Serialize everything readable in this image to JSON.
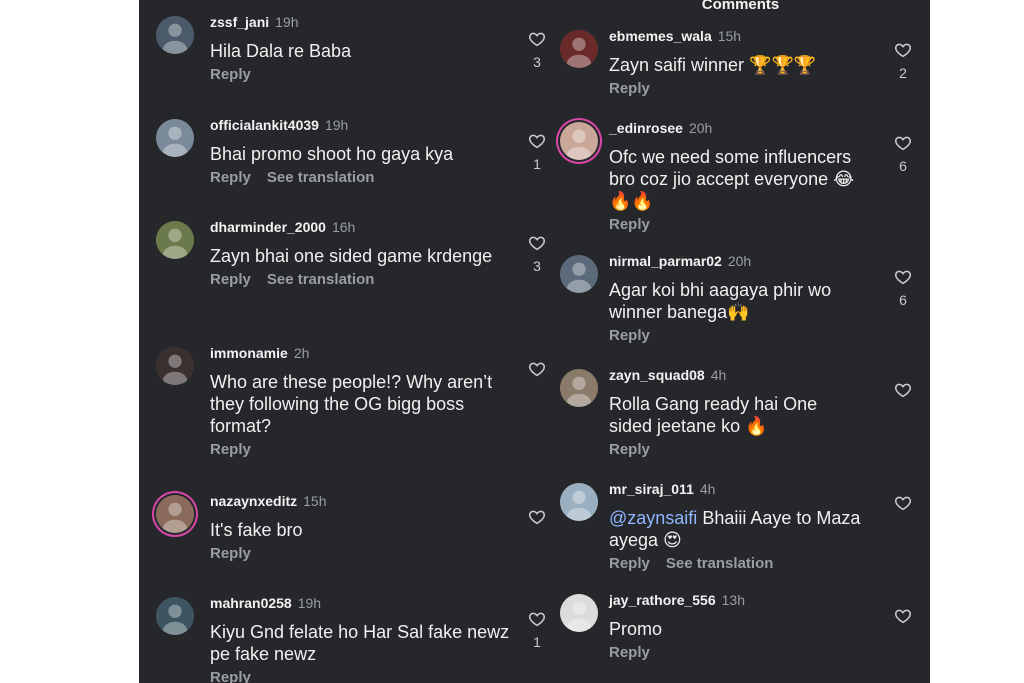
{
  "header": {
    "title": "Comments"
  },
  "left_comments": [
    {
      "user": "zssf_jani",
      "time": "19h",
      "text": "Hila Dala re Baba",
      "actions": [
        "Reply"
      ],
      "likes": "3",
      "avatar_color": "#4a5a6a"
    },
    {
      "user": "officialankit4039",
      "time": "19h",
      "text": "Bhai promo shoot ho gaya kya",
      "actions": [
        "Reply",
        "See translation"
      ],
      "likes": "1",
      "avatar_color": "#7a8a9a"
    },
    {
      "user": "dharminder_2000",
      "time": "16h",
      "text": "Zayn bhai one sided game krdenge",
      "actions": [
        "Reply",
        "See translation"
      ],
      "likes": "3",
      "avatar_color": "#6b7a4a"
    },
    {
      "user": "immonamie",
      "time": "2h",
      "text": "Who are these people!? Why aren’t they following the OG bigg boss format?",
      "actions": [
        "Reply"
      ],
      "likes": "",
      "avatar_color": "#3a3030"
    },
    {
      "user": "nazaynxeditz",
      "time": "15h",
      "text": "It's fake bro",
      "actions": [
        "Reply"
      ],
      "likes": "",
      "avatar_color": "#8a6a5a"
    },
    {
      "user": "mahran0258",
      "time": "19h",
      "text": "Kiyu Gnd felate ho Har Sal fake newz pe fake newz",
      "actions": [
        "Reply"
      ],
      "likes": "1",
      "avatar_color": "#3d5560"
    }
  ],
  "right_comments": [
    {
      "user": "ebmemes_wala",
      "time": "15h",
      "text": "Zayn saifi winner 🏆🏆🏆",
      "actions": [
        "Reply"
      ],
      "likes": "2",
      "avatar_color": "#6a2a2a"
    },
    {
      "user": "_edinrosee",
      "time": "20h",
      "text": "Ofc we need some influencers bro coz jio accept everyone 😂 🔥🔥",
      "actions": [
        "Reply"
      ],
      "likes": "6",
      "avatar_color": "#c9a89a"
    },
    {
      "user": "nirmal_parmar02",
      "time": "20h",
      "text": "Agar koi bhi aagaya phir wo winner banega🙌",
      "actions": [
        "Reply"
      ],
      "likes": "6",
      "avatar_color": "#5a6a7a"
    },
    {
      "user": "zayn_squad08",
      "time": "4h",
      "text": "Rolla Gang ready hai One sided jeetane ko 🔥",
      "actions": [
        "Reply"
      ],
      "likes": "",
      "avatar_color": "#8a7a6a"
    },
    {
      "user": "mr_siraj_011",
      "time": "4h",
      "mention": "@zaynsaifi",
      "text": " Bhaiii Aaye to Maza ayega 😍",
      "actions": [
        "Reply",
        "See translation"
      ],
      "likes": "",
      "avatar_color": "#9ab0c0"
    },
    {
      "user": "jay_rathore_556",
      "time": "13h",
      "text": "Promo",
      "actions": [
        "Reply"
      ],
      "likes": "",
      "avatar_color": "#dcdcdc"
    }
  ]
}
